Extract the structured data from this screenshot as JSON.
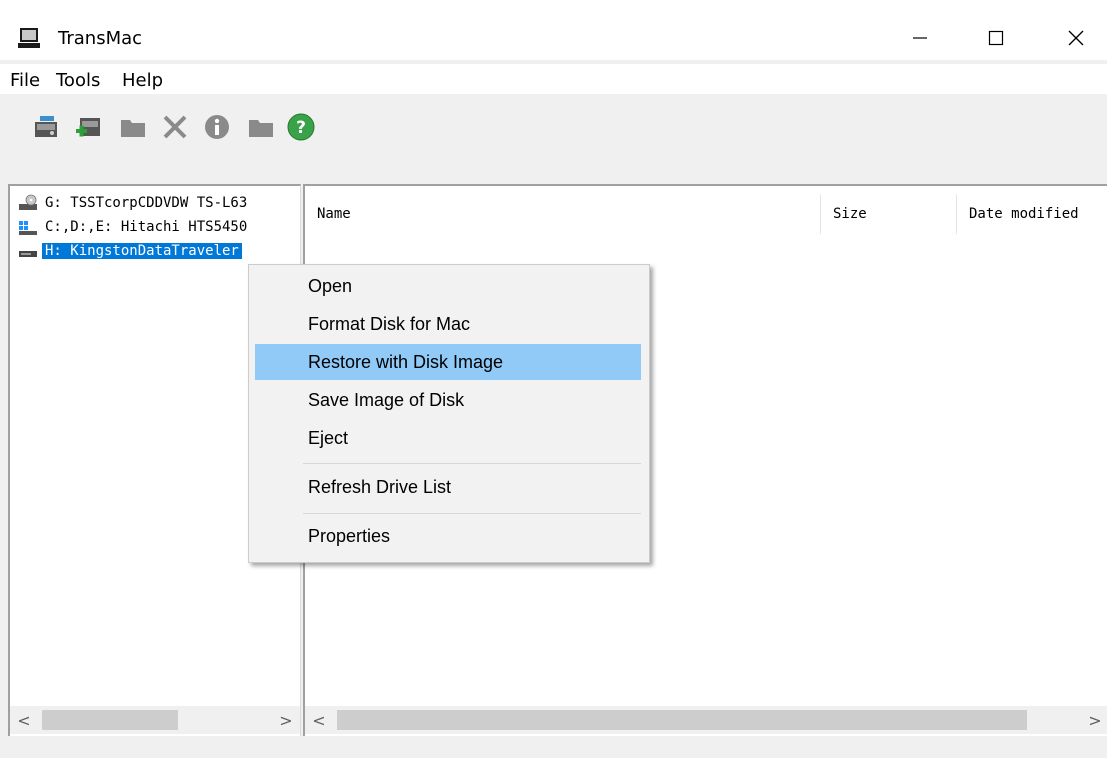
{
  "window": {
    "title": "TransMac"
  },
  "caption_buttons": {
    "minimize": "—",
    "maximize": "☐",
    "close": "✕"
  },
  "menubar": {
    "items": [
      "File",
      "Tools",
      "Help"
    ]
  },
  "toolbar": {
    "buttons": [
      {
        "icon": "open-disk-icon"
      },
      {
        "icon": "new-disk-image-icon"
      },
      {
        "icon": "folder-icon"
      },
      {
        "icon": "delete-icon"
      },
      {
        "icon": "info-icon"
      },
      {
        "icon": "new-folder-icon"
      },
      {
        "icon": "help-icon"
      }
    ]
  },
  "drives": [
    {
      "label": "G: TSSTcorpCDDVDW TS-L63",
      "icon": "optical-drive-icon",
      "selected": false
    },
    {
      "label": "C:,D:,E: Hitachi HTS5450",
      "icon": "windows-drive-icon",
      "selected": false
    },
    {
      "label": "H: KingstonDataTraveler",
      "icon": "usb-drive-icon",
      "selected": true
    }
  ],
  "file_list": {
    "columns": [
      "Name",
      "Size",
      "Date modified"
    ]
  },
  "scrollbars": {
    "left_arrow": "<",
    "right_arrow": ">"
  },
  "context_menu": {
    "items": [
      "Open",
      "Format Disk for Mac",
      "Restore with Disk Image",
      "Save Image of Disk",
      "Eject",
      "Refresh Drive List",
      "Properties"
    ],
    "highlighted": "Restore with Disk Image"
  },
  "colors": {
    "selection": "#0078d7",
    "menu_hover": "#91c9f7",
    "help_green": "#3aa34a"
  }
}
